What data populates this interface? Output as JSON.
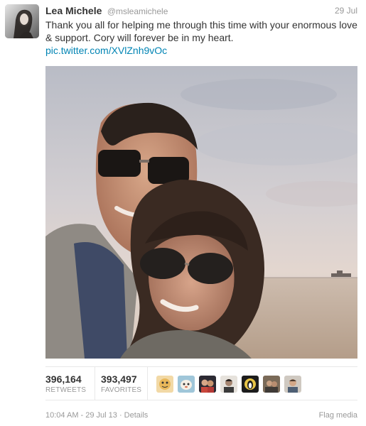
{
  "tweet": {
    "author_name": "Lea Michele",
    "author_handle": "@msleamichele",
    "date": "29 Jul",
    "text": "Thank you all for helping me through this time with your enormous love & support. Cory will forever be in my heart.",
    "link": "pic.twitter.com/XVlZnh9vOc"
  },
  "stats": {
    "retweets_count": "396,164",
    "retweets_label": "RETWEETS",
    "favorites_count": "393,497",
    "favorites_label": "FAVORITES"
  },
  "favoriters": [
    {
      "icon": "user-avatar-cartoon-icon",
      "color": "#e9b85a"
    },
    {
      "icon": "user-avatar-mascot-icon",
      "color": "#9fc6d9"
    },
    {
      "icon": "user-avatar-couple-icon",
      "color": "#c9473c"
    },
    {
      "icon": "user-avatar-portrait-icon",
      "color": "#e6e2dc"
    },
    {
      "icon": "user-avatar-penguins-logo-icon",
      "color": "#1c1c1c"
    },
    {
      "icon": "user-avatar-photo-icon",
      "color": "#7a6a58"
    },
    {
      "icon": "user-avatar-portrait-icon",
      "color": "#cfc9c1"
    }
  ],
  "footer": {
    "time": "10:04 AM - 29 Jul 13 · ",
    "details_label": "Details",
    "flag_media_label": "Flag media"
  },
  "colors": {
    "link": "#0084b4",
    "muted_text": "#999999",
    "body_text": "#333333"
  }
}
